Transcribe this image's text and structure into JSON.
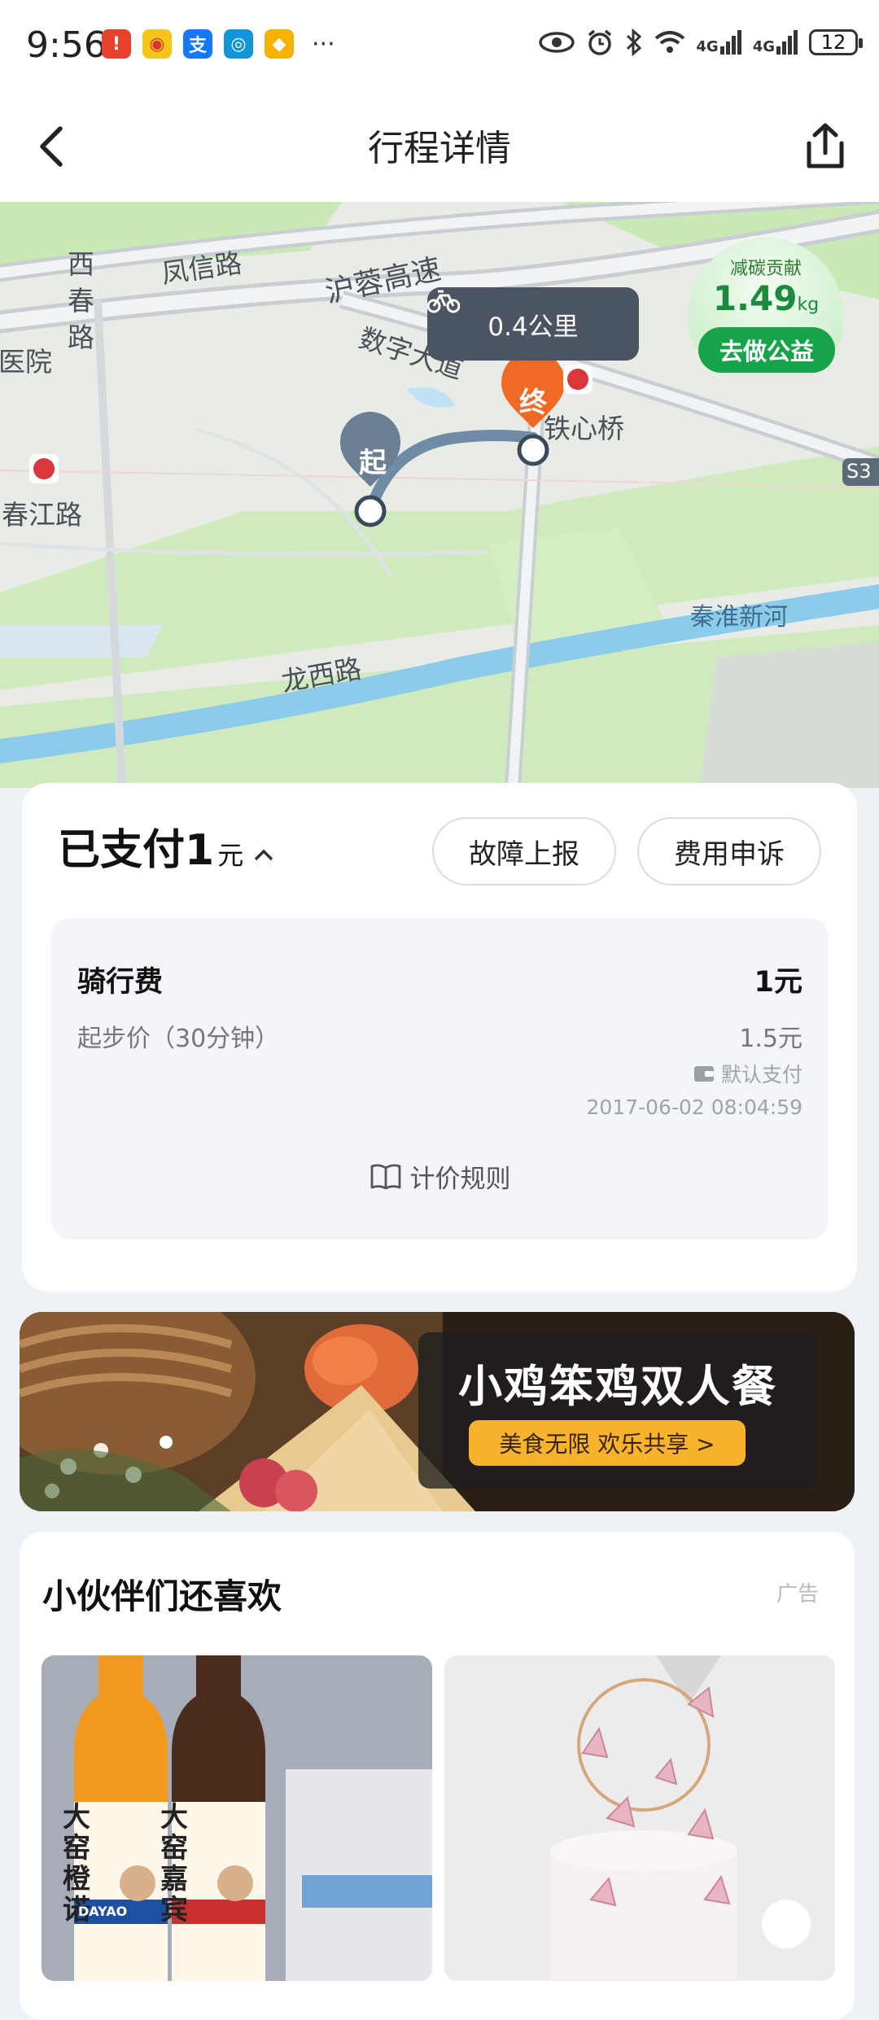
{
  "status_bar": {
    "time": "9:56",
    "battery": "12",
    "network_1": "4G",
    "network_2": "4G",
    "more": "···"
  },
  "nav": {
    "title": "行程详情",
    "back_icon": "chevron-left-icon",
    "share_icon": "share-icon"
  },
  "map": {
    "distance": "0.4公里",
    "start_label": "起",
    "end_label": "终",
    "labels": {
      "west_chun_road_1": "西",
      "west_chun_road_2": "春",
      "west_chun_road_3": "路",
      "fengxin_road": "凤信路",
      "hurong_expressway": "沪蓉高速",
      "digital_avenue": "数字大道",
      "hospital": "医院",
      "chunjiang_road": "春江路",
      "tiexin_bridge": "铁心桥",
      "longxi_road": "龙西路",
      "qinhuai_river": "秦淮新河",
      "s3": "S3"
    }
  },
  "carbon": {
    "title": "减碳贡献",
    "value": "1.49",
    "unit": "kg",
    "button": "去做公益"
  },
  "payment": {
    "status": "已支付",
    "amount": "1",
    "unit": "元",
    "fault_report": "故障上报",
    "fee_appeal": "费用申诉",
    "ride_fee_label": "骑行费",
    "ride_fee_value": "1元",
    "base_price_label": "起步价（30分钟）",
    "base_price_value": "1.5元",
    "pay_method": "默认支付",
    "timestamp": "2017-06-02 08:04:59",
    "pricing_rules": "计价规则"
  },
  "banner": {
    "title": "小鸡笨鸡双人餐",
    "subtitle": "美食无限 欢乐共享 >"
  },
  "recommendations": {
    "title": "小伙伴们还喜欢",
    "ad_label": "广告",
    "product_1_text": "大窑橙诺",
    "product_2_text": "大窑嘉宾",
    "brand": "DAYAO"
  },
  "colors": {
    "accent_green": "#17a34a",
    "end_marker": "#f06a25",
    "start_marker": "#6b7f93",
    "route": "#6f8ba6",
    "banner_button": "#f7b32b"
  }
}
